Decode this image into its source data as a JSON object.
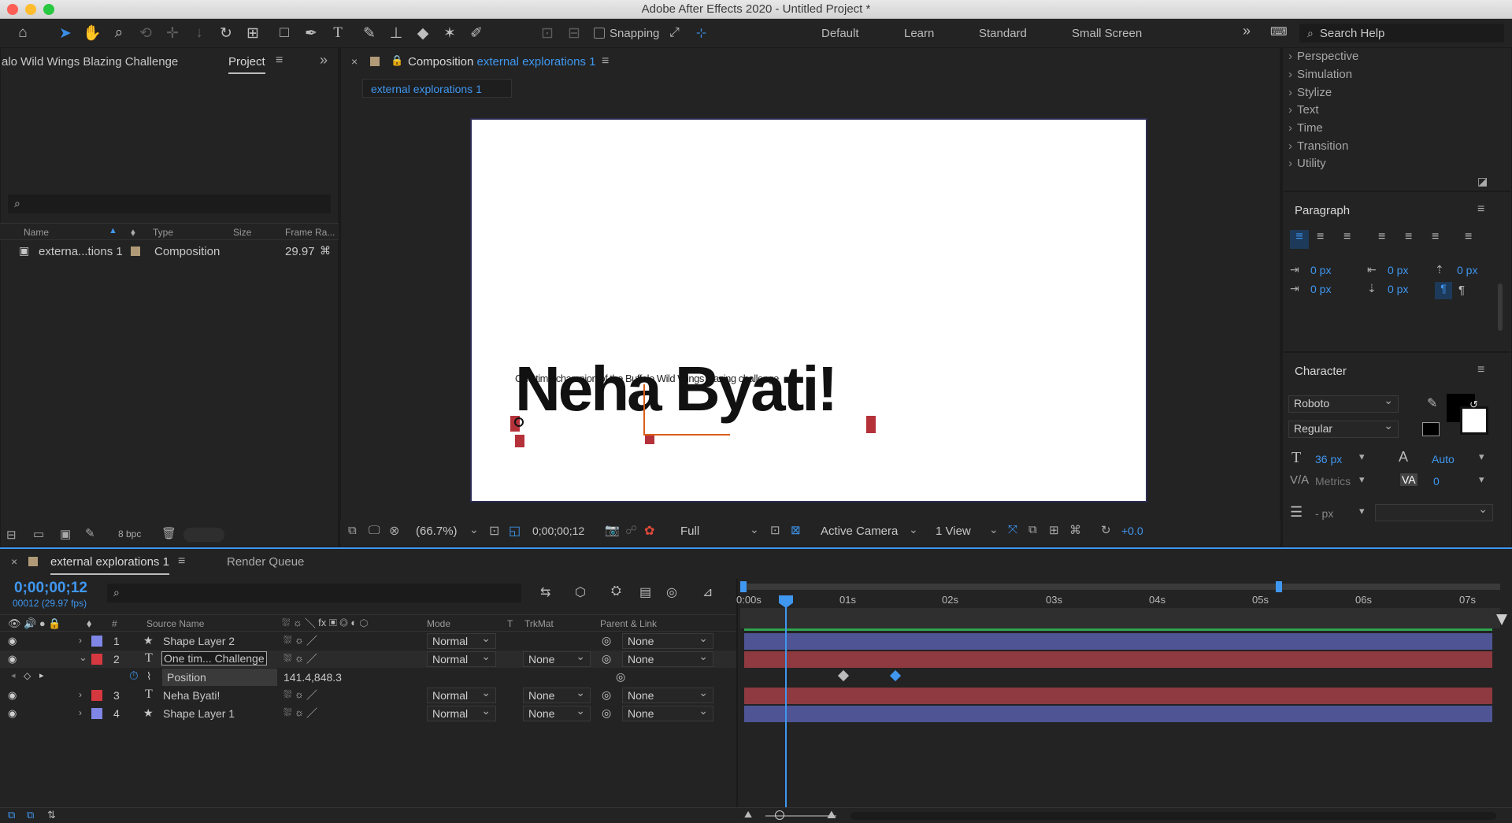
{
  "window": {
    "title": "Adobe After Effects 2020 - Untitled Project *"
  },
  "toolbar": {
    "snapping_label": "Snapping",
    "workspaces": [
      "Default",
      "Learn",
      "Standard",
      "Small Screen"
    ],
    "search_placeholder": "Search Help"
  },
  "project_panel": {
    "title_clipped": "alo Wild Wings Blazing Challenge",
    "tab": "Project",
    "columns": [
      "Name",
      "Type",
      "Size",
      "Frame Ra..."
    ],
    "items": [
      {
        "name": "externa...tions 1",
        "type": "Composition",
        "frame_rate": "29.97"
      }
    ],
    "bpc": "8 bpc"
  },
  "composition_panel": {
    "title_prefix": "Composition",
    "title_name": "external explorations 1",
    "breadcrumb": "external explorations 1",
    "canvas_title": "Neha Byati!",
    "canvas_subtext": "One time champion of the Buffalo Wild Wings blazing challenge",
    "zoom": "(66.7%)",
    "timecode": "0;00;00;12",
    "resolution": "Full",
    "camera": "Active Camera",
    "views": "1 View",
    "exposure": "+0.0"
  },
  "effects_panel": {
    "items": [
      "Perspective",
      "Simulation",
      "Stylize",
      "Text",
      "Time",
      "Transition",
      "Utility"
    ]
  },
  "paragraph_panel": {
    "title": "Paragraph",
    "indent_left": "0 px",
    "indent_right": "0 px",
    "space_before": "0 px",
    "first_line": "0 px",
    "space_after": "0 px"
  },
  "character_panel": {
    "title": "Character",
    "font": "Roboto",
    "style": "Regular",
    "size": "36 px",
    "leading": "Auto",
    "kerning": "Metrics",
    "tracking": "0",
    "stroke": "- px"
  },
  "timeline": {
    "tab": "external explorations 1",
    "render_queue": "Render Queue",
    "timecode": "0;00;00;12",
    "frame_info": "00012 (29.97 fps)",
    "columns": {
      "num": "#",
      "source": "Source Name",
      "mode": "Mode",
      "t": "T",
      "trkmat": "TrkMat",
      "parent": "Parent & Link"
    },
    "layers": [
      {
        "num": "1",
        "name": "Shape Layer 2",
        "mode": "Normal",
        "trkmat": "",
        "parent": "None",
        "color": "#7f86e6"
      },
      {
        "num": "2",
        "name": "One tim... Challenge",
        "mode": "Normal",
        "trkmat": "None",
        "parent": "None",
        "color": "#d6383f"
      },
      {
        "num": "3",
        "name": "Neha Byati!",
        "mode": "Normal",
        "trkmat": "None",
        "parent": "None",
        "color": "#d6383f"
      },
      {
        "num": "4",
        "name": "Shape Layer 1",
        "mode": "Normal",
        "trkmat": "None",
        "parent": "None",
        "color": "#7f86e6"
      }
    ],
    "property": {
      "name": "Position",
      "value": "141.4,848.3"
    },
    "ruler": [
      "0:00s",
      "01s",
      "02s",
      "03s",
      "04s",
      "05s",
      "06s",
      "07s"
    ]
  }
}
